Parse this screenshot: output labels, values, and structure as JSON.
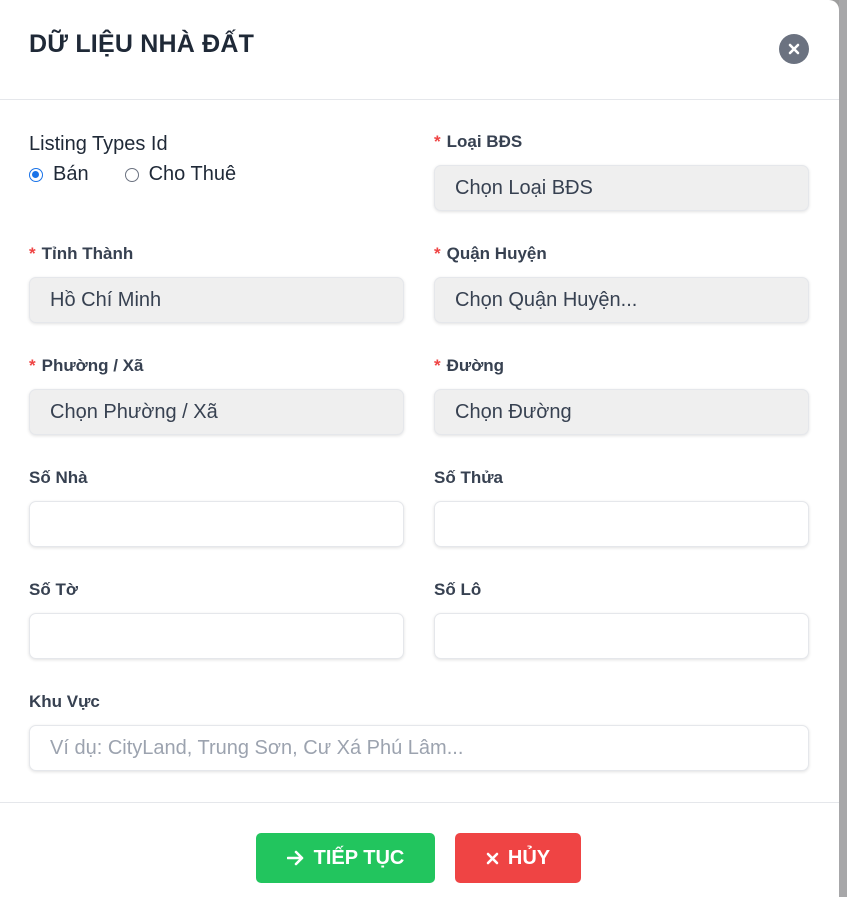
{
  "modal": {
    "title": "DỮ LIỆU NHÀ ĐẤT",
    "close_icon": "close-icon"
  },
  "listing_types": {
    "label": "Listing Types Id",
    "options": [
      {
        "label": "Bán",
        "checked": true
      },
      {
        "label": "Cho Thuê",
        "checked": false
      }
    ]
  },
  "fields": {
    "property_type": {
      "label": "Loại BĐS",
      "required": true,
      "value": "Chọn Loại BĐS"
    },
    "province": {
      "label": "Tỉnh Thành",
      "required": true,
      "value": "Hồ Chí Minh"
    },
    "district": {
      "label": "Quận Huyện",
      "required": true,
      "value": "Chọn Quận Huyện..."
    },
    "ward": {
      "label": "Phường / Xã",
      "required": true,
      "value": "Chọn Phường / Xã"
    },
    "street": {
      "label": "Đường",
      "required": true,
      "value": "Chọn Đường"
    },
    "house_number": {
      "label": "Số Nhà",
      "value": ""
    },
    "parcel_number": {
      "label": "Số Thửa",
      "value": ""
    },
    "sheet_number": {
      "label": "Số Tờ",
      "value": ""
    },
    "lot_number": {
      "label": "Số Lô",
      "value": ""
    },
    "area": {
      "label": "Khu Vực",
      "value": "",
      "placeholder": "Ví dụ: CityLand, Trung Sơn, Cư Xá Phú Lâm..."
    }
  },
  "required_marker": "*",
  "footer": {
    "continue_label": "TIẾP TỤC",
    "continue_icon": "arrow-right-icon",
    "cancel_label": "HỦY",
    "cancel_icon": "x-icon"
  },
  "colors": {
    "continue": "#22c55e",
    "cancel": "#ef4444",
    "required": "#ef4444",
    "radio_checked": "#1a73e8",
    "select_bg": "#efefef",
    "close_btn": "#6b7280"
  }
}
